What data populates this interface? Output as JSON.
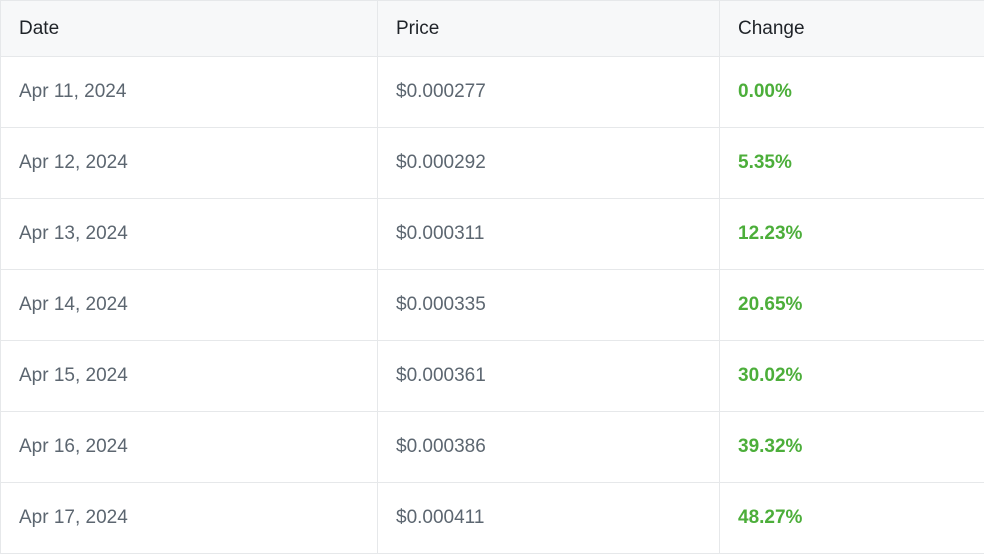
{
  "table": {
    "headers": {
      "date": "Date",
      "price": "Price",
      "change": "Change"
    },
    "rows": [
      {
        "date": "Apr 11, 2024",
        "price": "$0.000277",
        "change": "0.00%"
      },
      {
        "date": "Apr 12, 2024",
        "price": "$0.000292",
        "change": "5.35%"
      },
      {
        "date": "Apr 13, 2024",
        "price": "$0.000311",
        "change": "12.23%"
      },
      {
        "date": "Apr 14, 2024",
        "price": "$0.000335",
        "change": "20.65%"
      },
      {
        "date": "Apr 15, 2024",
        "price": "$0.000361",
        "change": "30.02%"
      },
      {
        "date": "Apr 16, 2024",
        "price": "$0.000386",
        "change": "39.32%"
      },
      {
        "date": "Apr 17, 2024",
        "price": "$0.000411",
        "change": "48.27%"
      }
    ]
  },
  "colors": {
    "positive_change": "#4cae3a",
    "header_background": "#f7f8f9",
    "border": "#e6e8ea"
  }
}
